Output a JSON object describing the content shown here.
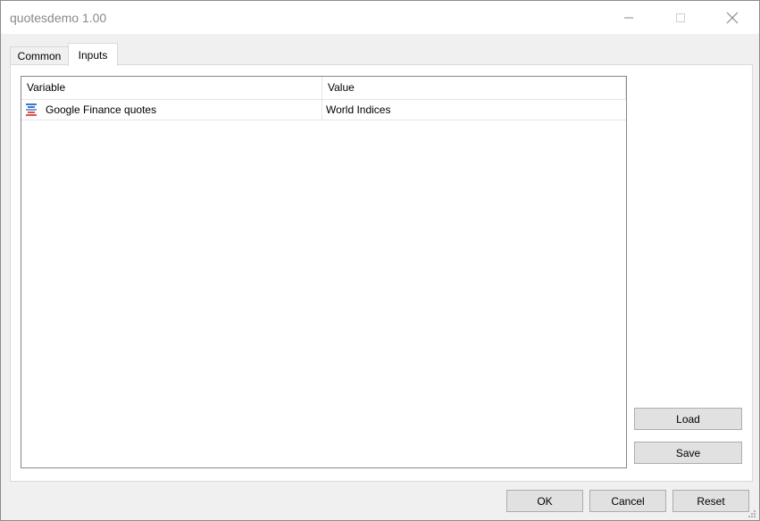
{
  "window": {
    "title": "quotesdemo 1.00"
  },
  "tabs": [
    {
      "label": "Common",
      "active": false
    },
    {
      "label": "Inputs",
      "active": true
    }
  ],
  "inputs_table": {
    "columns": [
      "Variable",
      "Value"
    ],
    "rows": [
      {
        "icon": "input-parameter-icon",
        "variable": "Google Finance quotes",
        "value": "World Indices"
      }
    ]
  },
  "side_buttons": {
    "load": "Load",
    "save": "Save"
  },
  "footer_buttons": {
    "ok": "OK",
    "cancel": "Cancel",
    "reset": "Reset"
  }
}
